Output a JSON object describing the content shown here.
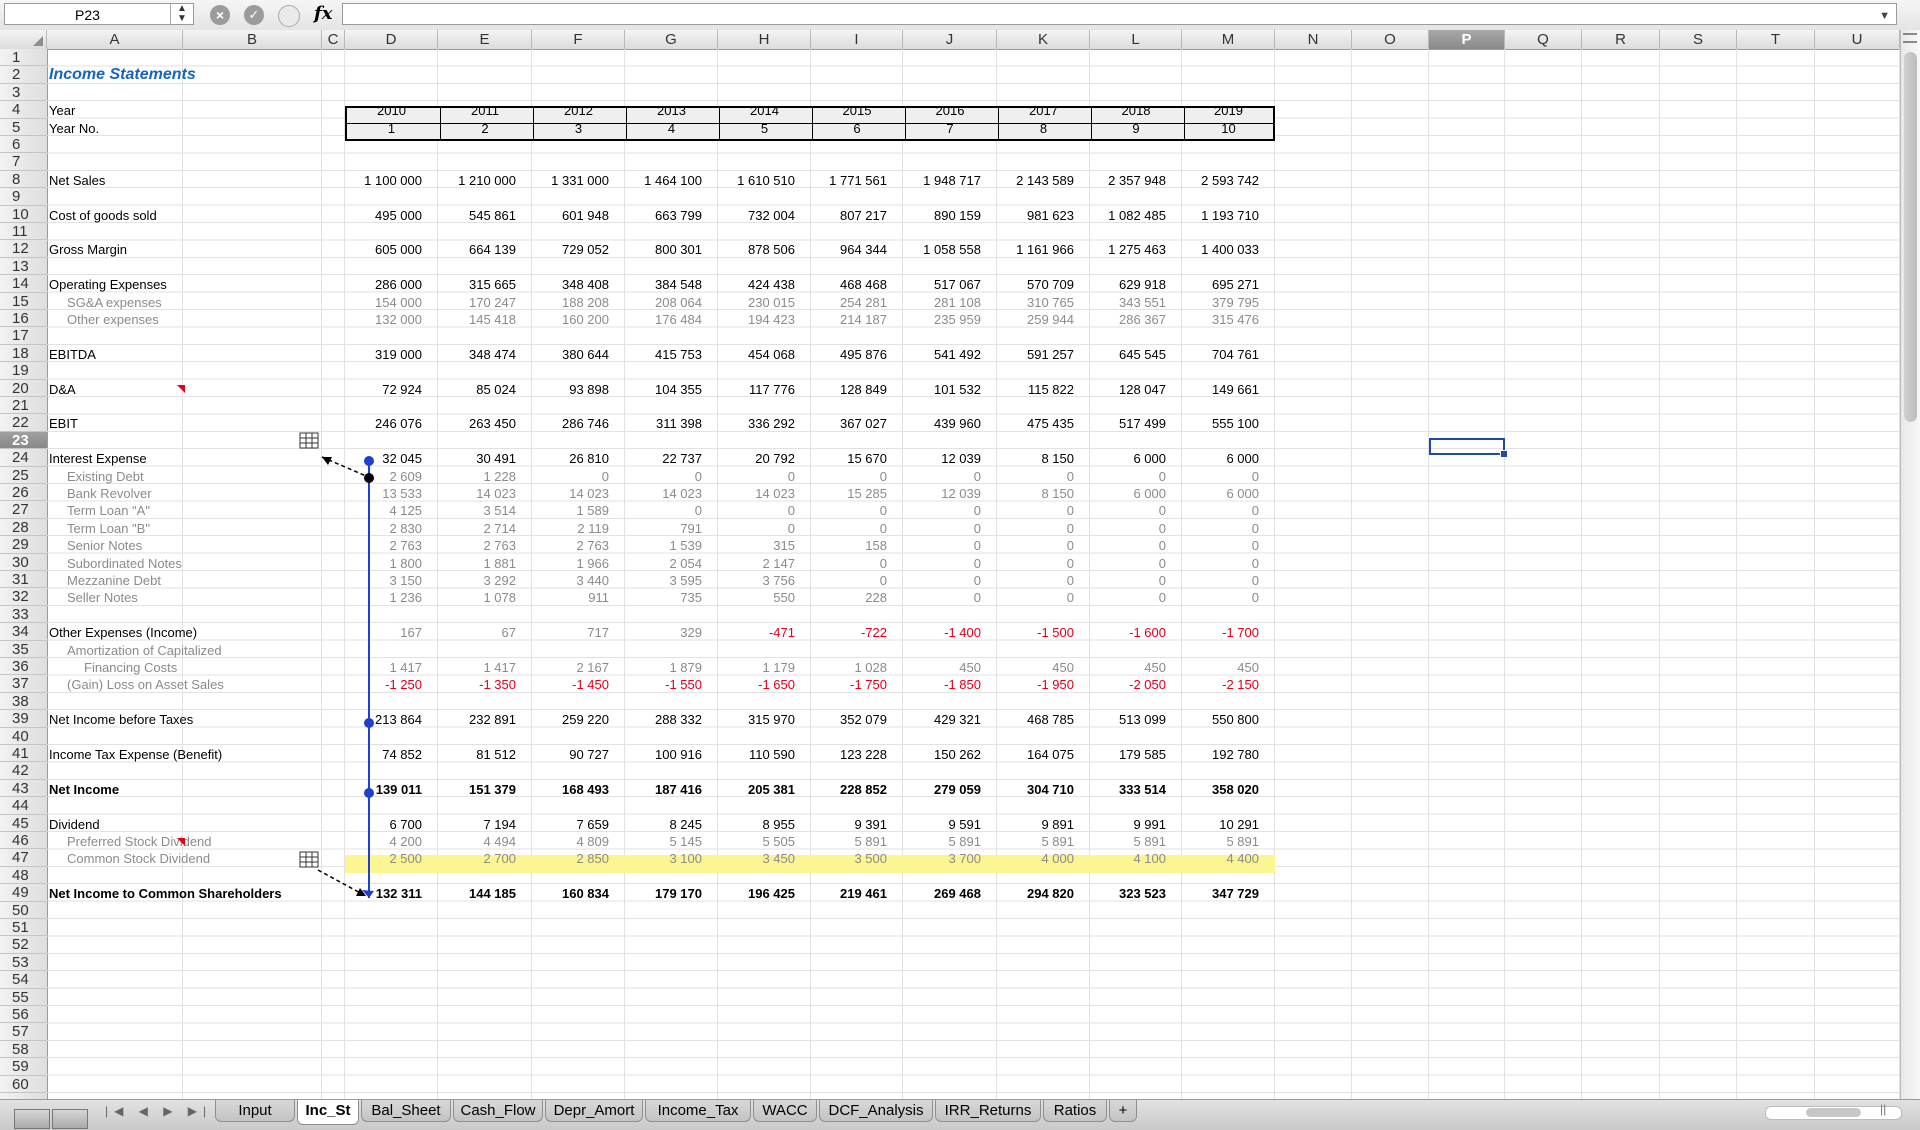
{
  "name_box": "P23",
  "formula": "",
  "columns": [
    "A",
    "B",
    "C",
    "D",
    "E",
    "F",
    "G",
    "H",
    "I",
    "J",
    "K",
    "L",
    "M",
    "N",
    "O",
    "P",
    "Q",
    "R",
    "S",
    "T",
    "U"
  ],
  "selected_column": "P",
  "selected_row": 23,
  "row_count": 60,
  "title": "Income Statements",
  "years": [
    "2010",
    "2011",
    "2012",
    "2013",
    "2014",
    "2015",
    "2016",
    "2017",
    "2018",
    "2019"
  ],
  "year_nos": [
    "1",
    "2",
    "3",
    "4",
    "5",
    "6",
    "7",
    "8",
    "9",
    "10"
  ],
  "rows": [
    {
      "r": 4,
      "label": "Year",
      "style": "normal"
    },
    {
      "r": 5,
      "label": "Year No.",
      "style": "normal"
    },
    {
      "r": 8,
      "label": "Net Sales",
      "style": "normal",
      "values": [
        "1 100 000",
        "1 210 000",
        "1 331 000",
        "1 464 100",
        "1 610 510",
        "1 771 561",
        "1 948 717",
        "2 143 589",
        "2 357 948",
        "2 593 742"
      ]
    },
    {
      "r": 10,
      "label": "Cost of goods sold",
      "style": "normal",
      "values": [
        "495 000",
        "545 861",
        "601 948",
        "663 799",
        "732 004",
        "807 217",
        "890 159",
        "981 623",
        "1 082 485",
        "1 193 710"
      ]
    },
    {
      "r": 12,
      "label": "Gross Margin",
      "style": "normal",
      "values": [
        "605 000",
        "664 139",
        "729 052",
        "800 301",
        "878 506",
        "964 344",
        "1 058 558",
        "1 161 966",
        "1 275 463",
        "1 400 033"
      ]
    },
    {
      "r": 14,
      "label": "Operating Expenses",
      "style": "normal",
      "values": [
        "286 000",
        "315 665",
        "348 408",
        "384 548",
        "424 438",
        "468 468",
        "517 067",
        "570 709",
        "629 918",
        "695 271"
      ]
    },
    {
      "r": 15,
      "label": "SG&A expenses",
      "style": "sub",
      "values": [
        "154 000",
        "170 247",
        "188 208",
        "208 064",
        "230 015",
        "254 281",
        "281 108",
        "310 765",
        "343 551",
        "379 795"
      ]
    },
    {
      "r": 16,
      "label": "Other expenses",
      "style": "sub",
      "values": [
        "132 000",
        "145 418",
        "160 200",
        "176 484",
        "194 423",
        "214 187",
        "235 959",
        "259 944",
        "286 367",
        "315 476"
      ]
    },
    {
      "r": 18,
      "label": "EBITDA",
      "style": "normal",
      "values": [
        "319 000",
        "348 474",
        "380 644",
        "415 753",
        "454 068",
        "495 876",
        "541 492",
        "591 257",
        "645 545",
        "704 761"
      ]
    },
    {
      "r": 20,
      "label": "D&A",
      "style": "normal",
      "values": [
        "72 924",
        "85 024",
        "93 898",
        "104 355",
        "117 776",
        "128 849",
        "101 532",
        "115 822",
        "128 047",
        "149 661"
      ]
    },
    {
      "r": 22,
      "label": "EBIT",
      "style": "normal",
      "values": [
        "246 076",
        "263 450",
        "286 746",
        "311 398",
        "336 292",
        "367 027",
        "439 960",
        "475 435",
        "517 499",
        "555 100"
      ]
    },
    {
      "r": 24,
      "label": "Interest Expense",
      "style": "normal",
      "values": [
        "32 045",
        "30 491",
        "26 810",
        "22 737",
        "20 792",
        "15 670",
        "12 039",
        "8 150",
        "6 000",
        "6 000"
      ]
    },
    {
      "r": 25,
      "label": "Existing Debt",
      "style": "sub",
      "values": [
        "2 609",
        "1 228",
        "0",
        "0",
        "0",
        "0",
        "0",
        "0",
        "0",
        "0"
      ]
    },
    {
      "r": 26,
      "label": "Bank Revolver",
      "style": "sub",
      "values": [
        "13 533",
        "14 023",
        "14 023",
        "14 023",
        "14 023",
        "15 285",
        "12 039",
        "8 150",
        "6 000",
        "6 000"
      ]
    },
    {
      "r": 27,
      "label": "Term Loan \"A\"",
      "style": "sub",
      "values": [
        "4 125",
        "3 514",
        "1 589",
        "0",
        "0",
        "0",
        "0",
        "0",
        "0",
        "0"
      ]
    },
    {
      "r": 28,
      "label": "Term Loan \"B\"",
      "style": "sub",
      "values": [
        "2 830",
        "2 714",
        "2 119",
        "791",
        "0",
        "0",
        "0",
        "0",
        "0",
        "0"
      ]
    },
    {
      "r": 29,
      "label": "Senior Notes",
      "style": "sub",
      "values": [
        "2 763",
        "2 763",
        "2 763",
        "1 539",
        "315",
        "158",
        "0",
        "0",
        "0",
        "0"
      ]
    },
    {
      "r": 30,
      "label": "Subordinated Notes",
      "style": "sub",
      "values": [
        "1 800",
        "1 881",
        "1 966",
        "2 054",
        "2 147",
        "0",
        "0",
        "0",
        "0",
        "0"
      ]
    },
    {
      "r": 31,
      "label": "Mezzanine Debt",
      "style": "sub",
      "values": [
        "3 150",
        "3 292",
        "3 440",
        "3 595",
        "3 756",
        "0",
        "0",
        "0",
        "0",
        "0"
      ]
    },
    {
      "r": 32,
      "label": "Seller Notes",
      "style": "sub",
      "values": [
        "1 236",
        "1 078",
        "911",
        "735",
        "550",
        "228",
        "0",
        "0",
        "0",
        "0"
      ]
    },
    {
      "r": 34,
      "label": "Other Expenses (Income)",
      "style": "normal",
      "values": [
        "167",
        "67",
        "717",
        "329",
        "-471",
        "-722",
        "-1 400",
        "-1 500",
        "-1 600",
        "-1 700"
      ],
      "vstyle": [
        "g",
        "g",
        "g",
        "g",
        "r",
        "r",
        "r",
        "r",
        "r",
        "r"
      ]
    },
    {
      "r": 35,
      "label": "Amortization of Capitalized",
      "style": "sub"
    },
    {
      "r": 36,
      "label": "Financing Costs",
      "style": "sub2",
      "values": [
        "1 417",
        "1 417",
        "2 167",
        "1 879",
        "1 179",
        "1 028",
        "450",
        "450",
        "450",
        "450"
      ]
    },
    {
      "r": 37,
      "label": "(Gain) Loss on Asset Sales",
      "style": "sub",
      "values": [
        "-1 250",
        "-1 350",
        "-1 450",
        "-1 550",
        "-1 650",
        "-1 750",
        "-1 850",
        "-1 950",
        "-2 050",
        "-2 150"
      ],
      "vstyle": [
        "r",
        "r",
        "r",
        "r",
        "r",
        "r",
        "r",
        "r",
        "r",
        "r"
      ]
    },
    {
      "r": 39,
      "label": "Net Income before Taxes",
      "style": "normal",
      "values": [
        "213 864",
        "232 891",
        "259 220",
        "288 332",
        "315 970",
        "352 079",
        "429 321",
        "468 785",
        "513 099",
        "550 800"
      ]
    },
    {
      "r": 41,
      "label": "Income Tax Expense (Benefit)",
      "style": "normal",
      "values": [
        "74 852",
        "81 512",
        "90 727",
        "100 916",
        "110 590",
        "123 228",
        "150 262",
        "164 075",
        "179 585",
        "192 780"
      ]
    },
    {
      "r": 43,
      "label": "Net Income",
      "style": "bold",
      "values": [
        "139 011",
        "151 379",
        "168 493",
        "187 416",
        "205 381",
        "228 852",
        "279 059",
        "304 710",
        "333 514",
        "358 020"
      ]
    },
    {
      "r": 45,
      "label": "Dividend",
      "style": "normal",
      "values": [
        "6 700",
        "7 194",
        "7 659",
        "8 245",
        "8 955",
        "9 391",
        "9 591",
        "9 891",
        "9 991",
        "10 291"
      ]
    },
    {
      "r": 46,
      "label": "Preferred Stock Dividend",
      "style": "sub",
      "values": [
        "4 200",
        "4 494",
        "4 809",
        "5 145",
        "5 505",
        "5 891",
        "5 891",
        "5 891",
        "5 891",
        "5 891"
      ]
    },
    {
      "r": 47,
      "label": "Common Stock Dividend",
      "style": "sub",
      "values": [
        "2 500",
        "2 700",
        "2 850",
        "3 100",
        "3 450",
        "3 500",
        "3 700",
        "4 000",
        "4 100",
        "4 400"
      ]
    },
    {
      "r": 49,
      "label": "Net Income to Common Shareholders",
      "style": "bold",
      "values": [
        "132 311",
        "144 185",
        "160 834",
        "179 170",
        "196 425",
        "219 461",
        "269 468",
        "294 820",
        "323 523",
        "347 729"
      ]
    }
  ],
  "sheet_tabs": [
    "Input",
    "Inc_St",
    "Bal_Sheet",
    "Cash_Flow",
    "Depr_Amort",
    "Income_Tax",
    "WACC",
    "DCF_Analysis",
    "IRR_Returns",
    "Ratios",
    "+"
  ],
  "active_tab": "Inc_St",
  "colors": {
    "title": "#1565c0",
    "negative": "#e0001a",
    "highlight": "#fbf592",
    "tracer": "#1f3fd0",
    "selection": "#1f4ba5"
  }
}
